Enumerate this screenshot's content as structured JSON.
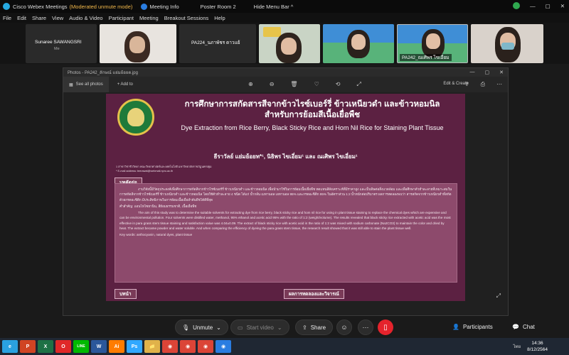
{
  "titlebar": {
    "app_name": "Cisco Webex Meetings",
    "mode": "(Moderated unmute mode)",
    "meeting_info": "Meeting Info",
    "room": "Poster Room 2",
    "hide_menu": "Hide Menu Bar",
    "chevron": "^"
  },
  "menu": [
    "File",
    "Edit",
    "Share",
    "View",
    "Audio & Video",
    "Participant",
    "Meeting",
    "Breakout Sessions",
    "Help"
  ],
  "participants": [
    {
      "name": "Sunaree SAWANGSRI",
      "sub": "Me"
    },
    {
      "name": ""
    },
    {
      "name": "PA224_นภาพัชร ดาวแย้"
    },
    {
      "name": ""
    },
    {
      "name": ""
    },
    {
      "name": "PA242_ณเศิพร ไขเอี่ยม"
    },
    {
      "name": ""
    }
  ],
  "photos": {
    "title": "Photos - PA242_ลักษณ์ แย่มย้อยต.jpg",
    "see_all": "See all photos",
    "add_to": "+ Add to",
    "edit_create": "Edit & Create",
    "window_controls": [
      "—",
      "▢",
      "✕"
    ],
    "toolbar_icons": [
      "⊕",
      "⊖",
      "🗑",
      "♡",
      "⟲",
      "⤢"
    ],
    "right_icons": [
      "⇪",
      "⎙",
      "⋯"
    ]
  },
  "poster": {
    "title_th_1": "การศึกษาการสกัดสารสีจากข้าวไรซ์เบอร์รี่ ข้าวเหนียวดำ และข้าวหอมนิล",
    "title_th_2": "สำหรับการย้อมสีเนื้อเยื่อพืช",
    "title_en": "Dye Extraction from Rice Berry, Black Sticky Rice and Hom Nil Rice for Staining Plant Tissue",
    "authors": "ธีราวัลย์ แย่มย้อยท*¹, นิธิพร ไขเอี่ยม¹ และ ณเศิพร ไขเอี่ยม¹",
    "affil_1": "1 สาขาวิชาชีววิทยา คณะวิทยาศาสตร์และเทคโนโลยี มหาวิทยาลัยราชภัฏนครปฐม",
    "affil_2": "* E-mail address: teerawat@webmail.npru.ac.th",
    "section_abstract_th": "บทคัดย่อ",
    "abstract_th": "งานวิจัยนี้มีวัตถุประสงค์เพื่อศึกษาการสกัดสีจากข้าวไรซ์เบอร์รี่ ข้าวเหนียวดำ และข้าวหอมนิล เพื่อนำมาใช้ในการย้อมเนื้อเยื่อพืช ทดแทนสีสังเคราะห์ที่มีราคาสูง และเป็นพิษต่อสิ่งแวดล้อม และเพื่อศึกษาตัวทำละลายที่เหมาะสมในการสกัดสีจากข้าวไรซ์เบอร์รี่ ข้าวเหนียวดำ และข้าวหอมนิล โดยใช้ตัวทำละลาย 4 ชนิด ได้แก่ น้ำกลั่น เมทานอล เอทานอล 95% และกรดอะซิติก 95% ในอัตราส่วน 1:2 น้ำหนักต่อปริมาตร ผลการทดลองพบว่า สารสกัดจากข้าวเหนียวดำที่สกัดด้วยกรดอะซิติก มีประสิทธิภาพในการย้อมเนื้อเยื่อลำต้นพืชได้ดีที่สุด",
    "abstract_en": "The aim of this study was to determine the suitable solvents for extracting dye from rice berry, black sticky rice and hom nil rice for using in plant tissue staining to replace the chemical dyes which are expensive and can be environmental pollution. Four solvents were distilled water, methanol, 95% ethanol and acetic acid 95% with the ratio of 1:2 (weight/volume). The results revealed that black sticky rice extracted with acetic acid was the most effective in para grass stem tissue staining and satisfaction value was 4.04±0.09. The extract of black sticky rice with acetic acid in the ratio of 1:2 was mixed with sodium carbonate (Na2CO3) to maintain the color and dried by heat. The extract became powder and water soluble. And when comparing the efficiency of dyeing the para grass stem tissue, the research result showed that it was still able to stain the plant tissue well.",
    "keywords_th": "คำสำคัญ: แอนโทไซยานิน, สีย้อมธรรมชาติ, เนื้อเยื่อพืช",
    "keywords_en": "Key words: anthocyanin, natural dyes, plant tissue",
    "section_intro": "บทนำ",
    "section_results": "ผลการทดลองและวิจารณ์"
  },
  "controls": {
    "unmute": "Unmute",
    "start_video": "Start video",
    "share": "Share",
    "participants": "Participants",
    "chat": "Chat",
    "more": "···"
  },
  "taskbar": {
    "apps": [
      "e",
      "P",
      "X",
      "O",
      "LINE",
      "W",
      "Ai",
      "Ps",
      "📁",
      "◉",
      "◉",
      "◉",
      "◉"
    ],
    "app_colors": [
      "#2aa1e0",
      "#d04423",
      "#1e7145",
      "#e02828",
      "#00b900",
      "#2b579a",
      "#ff7c00",
      "#31a8ff",
      "#e0b24a",
      "#db4437",
      "#db4437",
      "#db4437",
      "#2a7de1"
    ],
    "tray": "ไทย",
    "time": "14:36",
    "date": "8/12/2564"
  }
}
